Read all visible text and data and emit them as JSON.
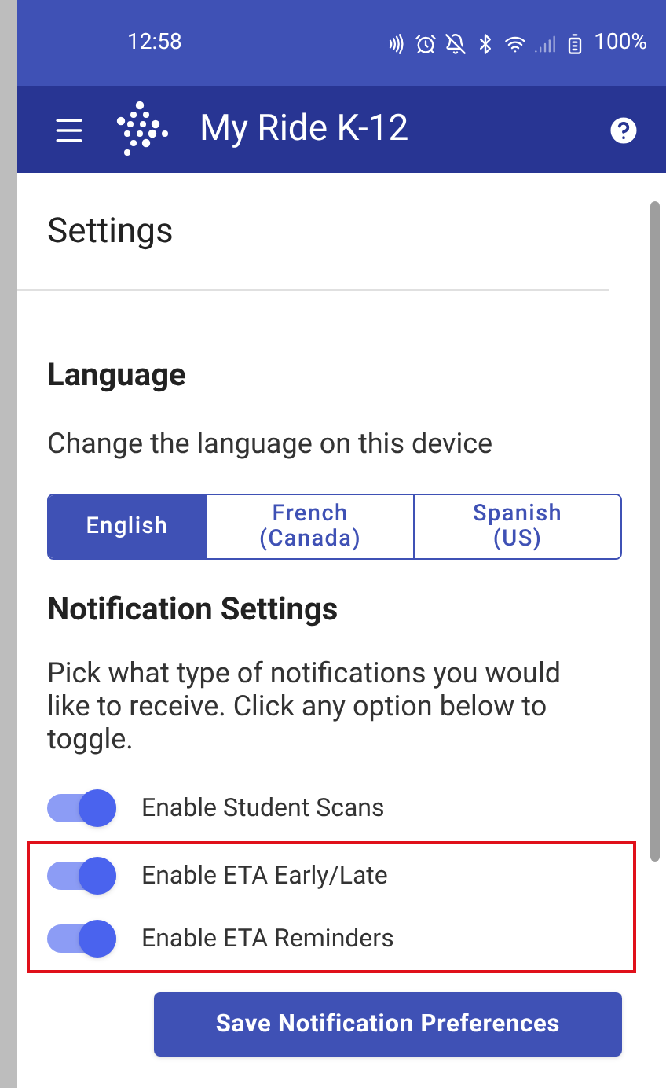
{
  "status_bar": {
    "time": "12:58",
    "battery": "100%"
  },
  "app_bar": {
    "title": "My Ride K-12"
  },
  "page": {
    "title": "Settings"
  },
  "language": {
    "heading": "Language",
    "description": "Change the language on this device",
    "options": [
      {
        "label": "English",
        "selected": true
      },
      {
        "label": "French\n(Canada)",
        "selected": false
      },
      {
        "label": "Spanish\n(US)",
        "selected": false
      }
    ]
  },
  "notifications": {
    "heading": "Notification Settings",
    "description": "Pick what type of notifications you would like to receive. Click any option below to toggle.",
    "toggles": [
      {
        "label": "Enable Student Scans",
        "on": true,
        "highlighted": false
      },
      {
        "label": "Enable ETA Early/Late",
        "on": true,
        "highlighted": true
      },
      {
        "label": "Enable ETA Reminders",
        "on": true,
        "highlighted": true
      }
    ],
    "save_button": "Save Notification Preferences"
  }
}
